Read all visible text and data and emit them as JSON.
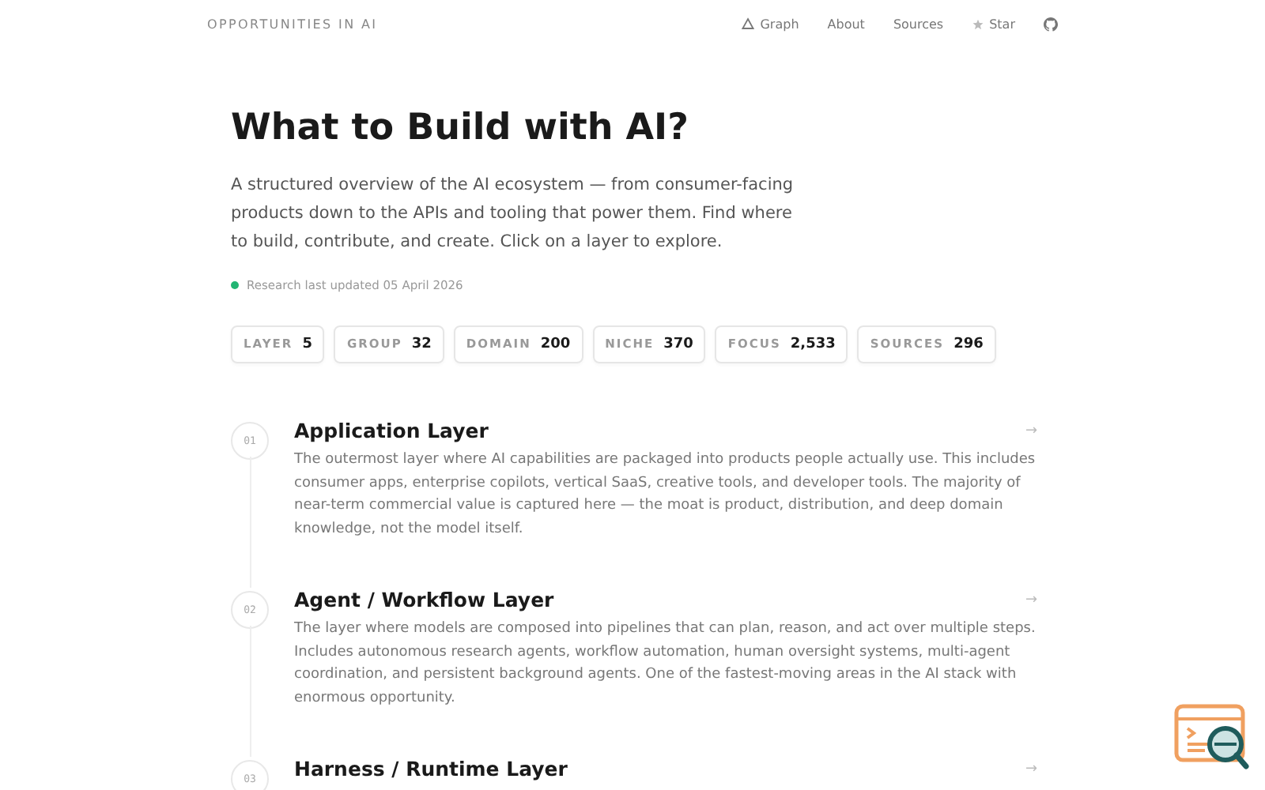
{
  "header": {
    "brand": "OPPORTUNITIES IN AI",
    "nav": [
      {
        "label": "Graph",
        "kind": "graph"
      },
      {
        "label": "About",
        "kind": "plain"
      },
      {
        "label": "Sources",
        "kind": "plain"
      },
      {
        "label": "Star",
        "kind": "star"
      }
    ]
  },
  "hero": {
    "title": "What to Build with AI?",
    "description": "A structured overview of the AI ecosystem — from consumer-facing products down to the APIs and tooling that power them. Find where to build, contribute, and create. Click on a layer to explore.",
    "status": {
      "text": "Research last updated 05 April 2026",
      "color": "#22b573"
    }
  },
  "stats": [
    {
      "label": "LAYER",
      "value": "5"
    },
    {
      "label": "GROUP",
      "value": "32"
    },
    {
      "label": "DOMAIN",
      "value": "200"
    },
    {
      "label": "NICHE",
      "value": "370"
    },
    {
      "label": "FOCUS",
      "value": "2,533"
    },
    {
      "label": "SOURCES",
      "value": "296"
    }
  ],
  "layers": [
    {
      "number": "01",
      "title": "Application Layer",
      "description": "The outermost layer where AI capabilities are packaged into products people actually use. This includes consumer apps, enterprise copilots, vertical SaaS, creative tools, and developer tools. The majority of near-term commercial value is captured here — the moat is product, distribution, and deep domain knowledge, not the model itself.",
      "arrow": "→"
    },
    {
      "number": "02",
      "title": "Agent / Workflow Layer",
      "description": "The layer where models are composed into pipelines that can plan, reason, and act over multiple steps. Includes autonomous research agents, workflow automation, human oversight systems, multi-agent coordination, and persistent background agents. One of the fastest-moving areas in the AI stack with enormous opportunity.",
      "arrow": "→"
    },
    {
      "number": "03",
      "title": "Harness / Runtime Layer",
      "arrow": "→"
    }
  ]
}
